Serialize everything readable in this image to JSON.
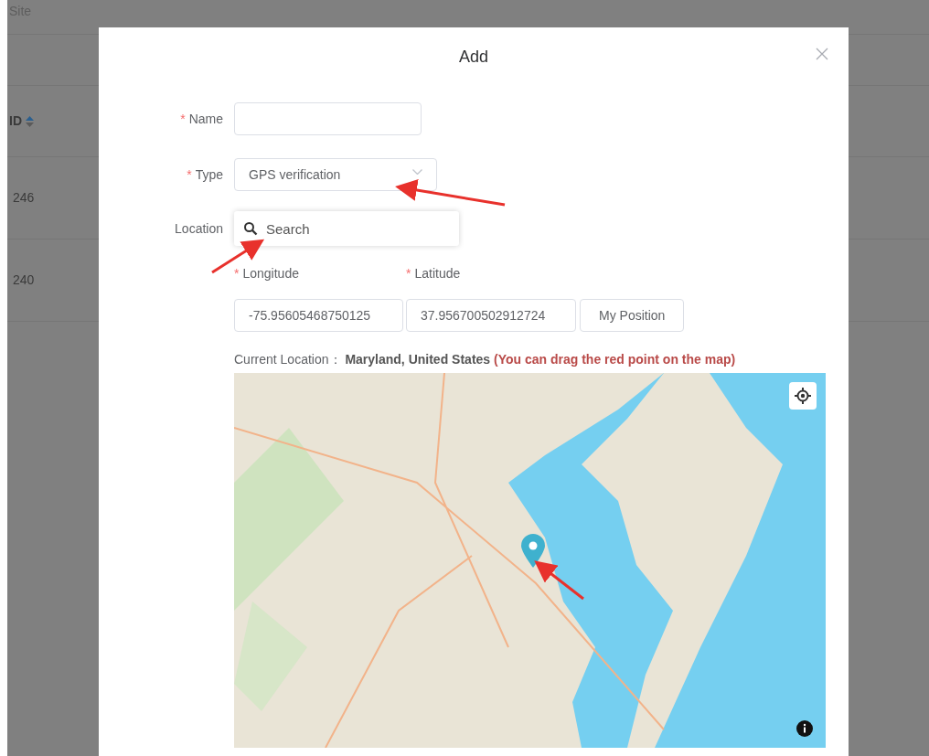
{
  "background_table": {
    "header": "Site",
    "columns": [
      {
        "label": "ID",
        "sortable": true
      }
    ],
    "rows": [
      "246",
      "240"
    ]
  },
  "dialog": {
    "title": "Add",
    "name": {
      "label": "Name",
      "mark": "*"
    },
    "type": {
      "label": "Type",
      "mark": "*",
      "value": "GPS verification"
    },
    "location": {
      "label": "Location",
      "placeholder": "Search"
    },
    "longitude": {
      "label": "Longitude",
      "mark": "*",
      "value": "-75.95605468750125"
    },
    "latitude": {
      "label": "Latitude",
      "mark": "*",
      "value": "37.956700502912724"
    },
    "position_button": "My Position",
    "current_location": {
      "label": "Current Location：",
      "value": "Maryland, United States",
      "hint": "(You can drag the red point on the map)"
    }
  }
}
